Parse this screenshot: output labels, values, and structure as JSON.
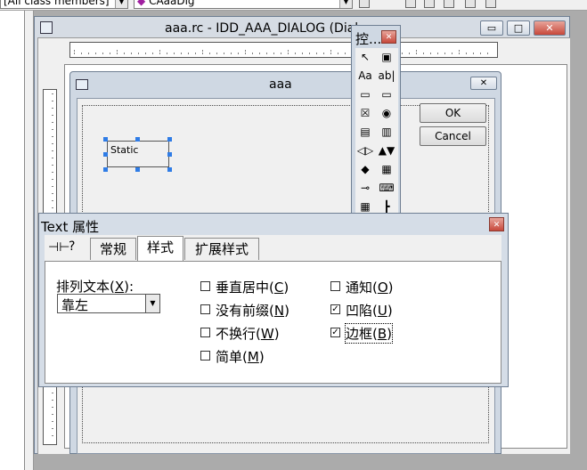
{
  "toolbar": {
    "class_combo": "[All class members]",
    "member_combo": "CAaaDlg"
  },
  "window": {
    "title": "aaa.rc - IDD_AAA_DIALOG (Dialo"
  },
  "dialog": {
    "title": "aaa",
    "ok_label": "OK",
    "cancel_label": "Cancel",
    "static_text": "Static"
  },
  "toolbox": {
    "title": "控...",
    "tools": [
      "pointer-icon",
      "picture-icon",
      "static-text-icon",
      "edit-box-icon",
      "group-box-icon",
      "button-icon",
      "checkbox-icon",
      "radio-icon",
      "combo-box-icon",
      "list-box-icon",
      "h-scroll-icon",
      "v-scroll-icon",
      "spin-icon",
      "progress-icon",
      "slider-icon",
      "hotkey-icon",
      "list-control-icon",
      "tree-control-icon"
    ],
    "glyphs": [
      "↖",
      "▣",
      "Aa",
      "ab|",
      "▭",
      "▭",
      "☒",
      "◉",
      "▤",
      "▥",
      "◁▷",
      "▲▼",
      "◆",
      "▦",
      "⊸",
      "⌨",
      "▦",
      "┣"
    ]
  },
  "properties": {
    "title": "Text 属性",
    "tabs": [
      "常规",
      "样式",
      "扩展样式"
    ],
    "align_label_pre": "排列文本(",
    "align_accel": "X",
    "align_label_post": "):",
    "align_value": "靠左",
    "options": [
      {
        "pre": "垂直居中(",
        "accel": "C",
        "post": ")",
        "checked": false
      },
      {
        "pre": "没有前缀(",
        "accel": "N",
        "post": ")",
        "checked": false
      },
      {
        "pre": "不换行(",
        "accel": "W",
        "post": ")",
        "checked": false
      },
      {
        "pre": "简单(",
        "accel": "M",
        "post": ")",
        "checked": false
      },
      {
        "pre": "通知(",
        "accel": "O",
        "post": ")",
        "checked": false
      },
      {
        "pre": "凹陷(",
        "accel": "U",
        "post": ")",
        "checked": true
      },
      {
        "pre": "边框(",
        "accel": "B",
        "post": ")",
        "checked": true
      }
    ]
  }
}
